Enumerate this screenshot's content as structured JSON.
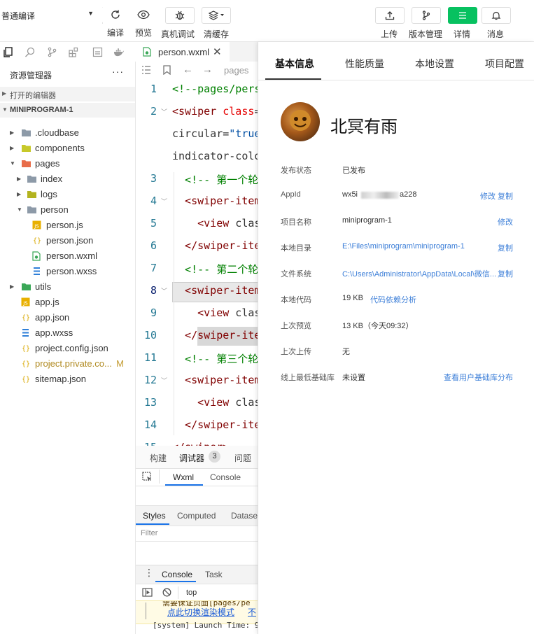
{
  "toolbar": {
    "mode": "普通编译",
    "buttons": {
      "compile": "编译",
      "preview": "预览",
      "real_debug": "真机调试",
      "clear_cache": "清缓存",
      "upload": "上传",
      "version": "版本管理",
      "detail": "详情",
      "message": "消息"
    }
  },
  "explorer": {
    "title": "资源管理器",
    "more": "···",
    "open_editors": "打开的编辑器",
    "project": "MINIPROGRAM-1",
    "items": [
      {
        "name": ".cloudbase"
      },
      {
        "name": "components"
      },
      {
        "name": "pages"
      },
      {
        "name": "index"
      },
      {
        "name": "logs"
      },
      {
        "name": "person"
      },
      {
        "name": "person.js"
      },
      {
        "name": "person.json"
      },
      {
        "name": "person.wxml"
      },
      {
        "name": "person.wxss"
      },
      {
        "name": "utils"
      },
      {
        "name": "app.js"
      },
      {
        "name": "app.json"
      },
      {
        "name": "app.wxss"
      },
      {
        "name": "project.config.json"
      },
      {
        "name": "project.private.co...",
        "badge": "M"
      },
      {
        "name": "sitemap.json"
      }
    ]
  },
  "editor": {
    "tab": "person.wxml",
    "breadcrumb": "pages",
    "lines": [
      {
        "n": "1",
        "parts": [
          [
            "cm",
            "<!--pages/pers"
          ]
        ]
      },
      {
        "n": "2",
        "parts": [
          [
            "tag",
            "<swiper"
          ],
          [
            "plain",
            " "
          ],
          [
            "attr",
            "class"
          ],
          [
            "plain",
            "="
          ]
        ]
      },
      {
        "n": "",
        "parts": [
          [
            "plain",
            "circular="
          ],
          [
            "str",
            "\"true"
          ]
        ]
      },
      {
        "n": "",
        "parts": [
          [
            "plain",
            "indicator-colo"
          ]
        ]
      },
      {
        "n": "3",
        "parts": [
          [
            "cm",
            "  <!-- 第一个轮"
          ]
        ]
      },
      {
        "n": "4",
        "parts": [
          [
            "tag",
            "  <swiper-item"
          ]
        ]
      },
      {
        "n": "5",
        "parts": [
          [
            "tag",
            "    <view"
          ],
          [
            "plain",
            " clas"
          ]
        ]
      },
      {
        "n": "6",
        "parts": [
          [
            "tag",
            "  </swiper-ite"
          ]
        ]
      },
      {
        "n": "7",
        "parts": [
          [
            "cm",
            "  <!-- 第二个轮"
          ]
        ]
      },
      {
        "n": "8",
        "parts": [
          [
            "tag",
            "  <swiper-item"
          ]
        ]
      },
      {
        "n": "9",
        "parts": [
          [
            "tag",
            "    <view"
          ],
          [
            "plain",
            " clas"
          ]
        ]
      },
      {
        "n": "10",
        "parts": [
          [
            "tag",
            "  </swiper-ite"
          ]
        ]
      },
      {
        "n": "11",
        "parts": [
          [
            "cm",
            "  <!-- 第三个轮"
          ]
        ]
      },
      {
        "n": "12",
        "parts": [
          [
            "tag",
            "  <swiper-item"
          ]
        ]
      },
      {
        "n": "13",
        "parts": [
          [
            "tag",
            "    <view"
          ],
          [
            "plain",
            " clas"
          ]
        ]
      },
      {
        "n": "14",
        "parts": [
          [
            "tag",
            "  </swiper-ite"
          ]
        ]
      },
      {
        "n": "15",
        "parts": [
          [
            "tag",
            "</swiper>"
          ]
        ]
      }
    ]
  },
  "bottom": {
    "tabs": [
      "构建",
      "调试器",
      "问题"
    ],
    "debugger_count": "3",
    "subtabs": [
      "Wxml",
      "Console"
    ],
    "style_tabs": [
      "Styles",
      "Computed",
      "Dataset"
    ],
    "filter_placeholder": "Filter",
    "console_tabs": [
      "Console",
      "Task"
    ],
    "context": "top",
    "log_line1": "需要保证页面[pages/pe",
    "log_link": "点此切换渲染模式",
    "log_link2": "不",
    "log_line3": "[system] Launch Time: 9"
  },
  "detail": {
    "tabs": [
      "基本信息",
      "性能质量",
      "本地设置",
      "项目配置"
    ],
    "name": "北冥有雨",
    "rows": [
      {
        "label": "发布状态",
        "value": "已发布",
        "link": ""
      },
      {
        "label": "AppId",
        "value": "wx5i",
        "value_tail": "a228",
        "link": "修改 复制"
      },
      {
        "label": "项目名称",
        "value": "miniprogram-1",
        "link": "修改"
      },
      {
        "label": "本地目录",
        "value": "E:\\Files\\miniprogram\\miniprogram-1",
        "value_is_link": true,
        "link": "复制"
      },
      {
        "label": "文件系统",
        "value": "C:\\Users\\Administrator\\AppData\\Local\\微信...",
        "value_is_link": true,
        "link": "复制"
      },
      {
        "label": "本地代码",
        "value": "19 KB",
        "inline_link": "代码依赖分析",
        "link": ""
      },
      {
        "label": "上次预览",
        "value": "13 KB（今天09:32）",
        "link": ""
      },
      {
        "label": "上次上传",
        "value": "无",
        "link": ""
      },
      {
        "label": "线上最低基础库",
        "value": "未设置",
        "link": "查看用户基础库分布"
      }
    ]
  }
}
